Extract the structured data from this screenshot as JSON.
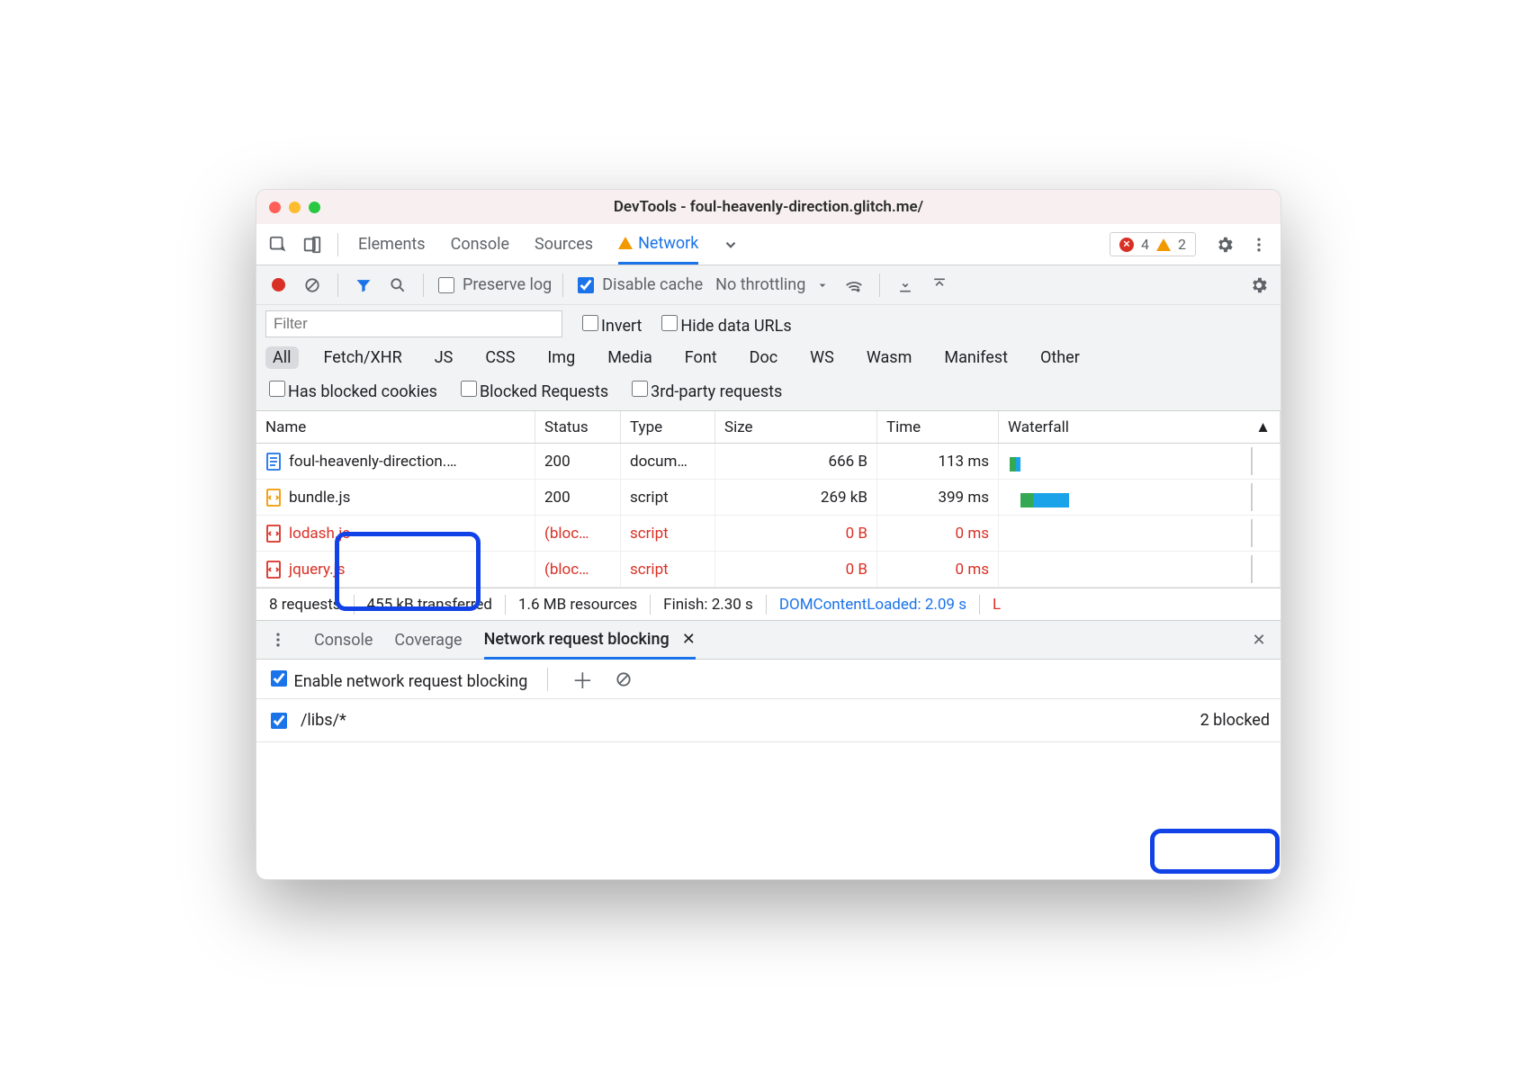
{
  "window": {
    "title": "DevTools - foul-heavenly-direction.glitch.me/"
  },
  "topTabs": {
    "items": [
      "Elements",
      "Console",
      "Sources",
      "Network"
    ],
    "activeIndex": 3,
    "errors": "4",
    "warnings": "2"
  },
  "toolbar": {
    "preserveLog": {
      "label": "Preserve log",
      "checked": false
    },
    "disableCache": {
      "label": "Disable cache",
      "checked": true
    },
    "throttling": "No throttling"
  },
  "filter": {
    "placeholder": "Filter",
    "invert": {
      "label": "Invert",
      "checked": false
    },
    "hideDataUrls": {
      "label": "Hide data URLs",
      "checked": false
    },
    "types": [
      "All",
      "Fetch/XHR",
      "JS",
      "CSS",
      "Img",
      "Media",
      "Font",
      "Doc",
      "WS",
      "Wasm",
      "Manifest",
      "Other"
    ],
    "activeType": 0,
    "hasBlockedCookies": {
      "label": "Has blocked cookies",
      "checked": false
    },
    "blockedRequests": {
      "label": "Blocked Requests",
      "checked": false
    },
    "thirdParty": {
      "label": "3rd-party requests",
      "checked": false
    }
  },
  "table": {
    "columns": [
      "Name",
      "Status",
      "Type",
      "Size",
      "Time",
      "Waterfall"
    ],
    "rows": [
      {
        "name": "foul-heavenly-direction.…",
        "status": "200",
        "type": "docum…",
        "size": "666 B",
        "time": "113 ms",
        "blocked": false,
        "icon": "doc",
        "wf": {
          "start": 2,
          "wait": 2,
          "down": 2,
          "colorA": "#34a853",
          "colorB": "#1aa3e8"
        }
      },
      {
        "name": "bundle.js",
        "status": "200",
        "type": "script",
        "size": "269 kB",
        "time": "399 ms",
        "blocked": false,
        "icon": "js",
        "wf": {
          "start": 6,
          "wait": 3,
          "down": 10,
          "colorA": "#34a853",
          "colorB": "#1aa3e8"
        }
      },
      {
        "name": "lodash.js",
        "status": "(bloc…",
        "type": "script",
        "size": "0 B",
        "time": "0 ms",
        "blocked": true,
        "icon": "js-blocked"
      },
      {
        "name": "jquery.js",
        "status": "(bloc…",
        "type": "script",
        "size": "0 B",
        "time": "0 ms",
        "blocked": true,
        "icon": "js-blocked"
      }
    ]
  },
  "summary": {
    "requests": "8 requests",
    "transferred": "455 kB transferred",
    "resources": "1.6 MB resources",
    "finish": "Finish: 2.30 s",
    "dcl": "DOMContentLoaded: 2.09 s",
    "load": "L"
  },
  "drawer": {
    "tabs": [
      "Console",
      "Coverage",
      "Network request blocking"
    ],
    "activeIndex": 2,
    "enable": {
      "label": "Enable network request blocking",
      "checked": true
    },
    "patterns": [
      {
        "pattern": "/libs/*",
        "checked": true,
        "blockedCount": "2 blocked"
      }
    ]
  }
}
